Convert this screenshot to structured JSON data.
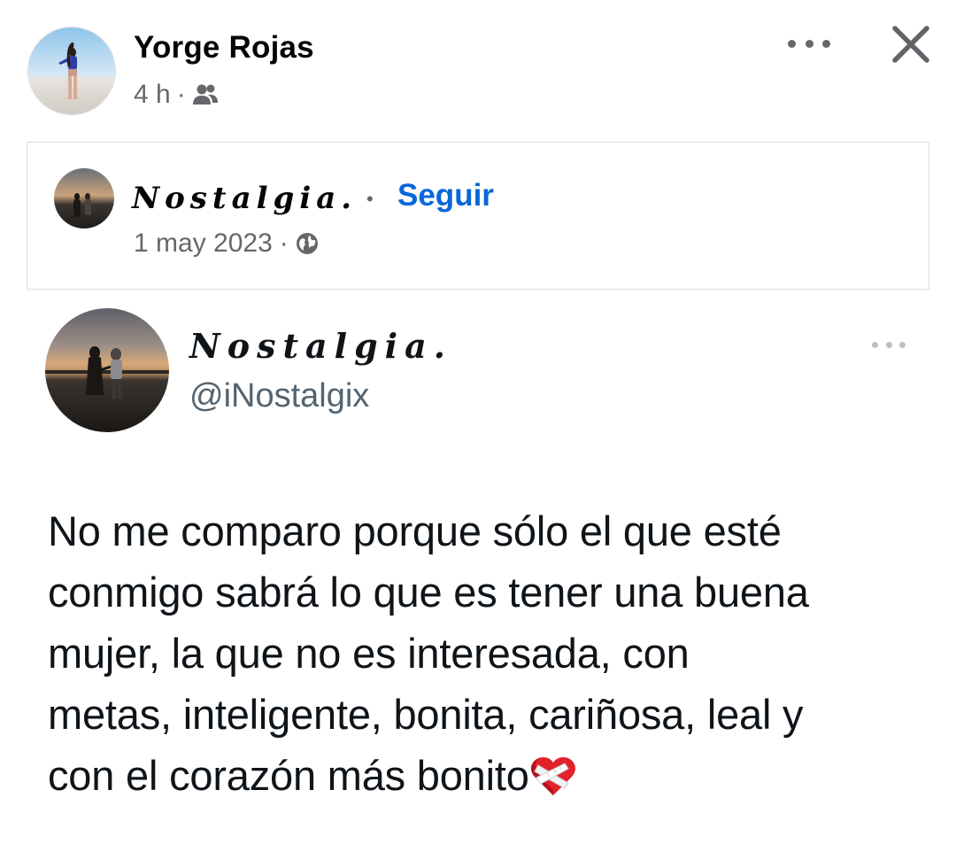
{
  "post": {
    "author_name": "Yorge Rojas",
    "time": "4 h",
    "separator": "·",
    "audience_icon": "friends-icon",
    "more_icon": "more-horizontal-icon",
    "close_icon": "close-icon"
  },
  "shared": {
    "page_name": "Nostalgia.",
    "separator": "•",
    "follow_label": "Seguir",
    "date": "1 may 2023",
    "meta_separator": "·",
    "privacy_icon": "globe-icon"
  },
  "tweet": {
    "display_name": "Nostalgia.",
    "handle": "@iNostalgix",
    "more_icon": "more-horizontal-icon",
    "lines": [
      "No me comparo porque sólo el que esté",
      "conmigo sabrá lo que es tener una buena",
      "mujer, la que no es interesada, con",
      "metas, inteligente, bonita, cariñosa, leal y",
      "con el corazón más bonito"
    ],
    "emoji_icon": "mending-heart-icon"
  },
  "colors": {
    "link_blue": "#0866d8",
    "meta_gray": "#65676b",
    "handle_gray": "#536471",
    "border": "#dadde1"
  }
}
